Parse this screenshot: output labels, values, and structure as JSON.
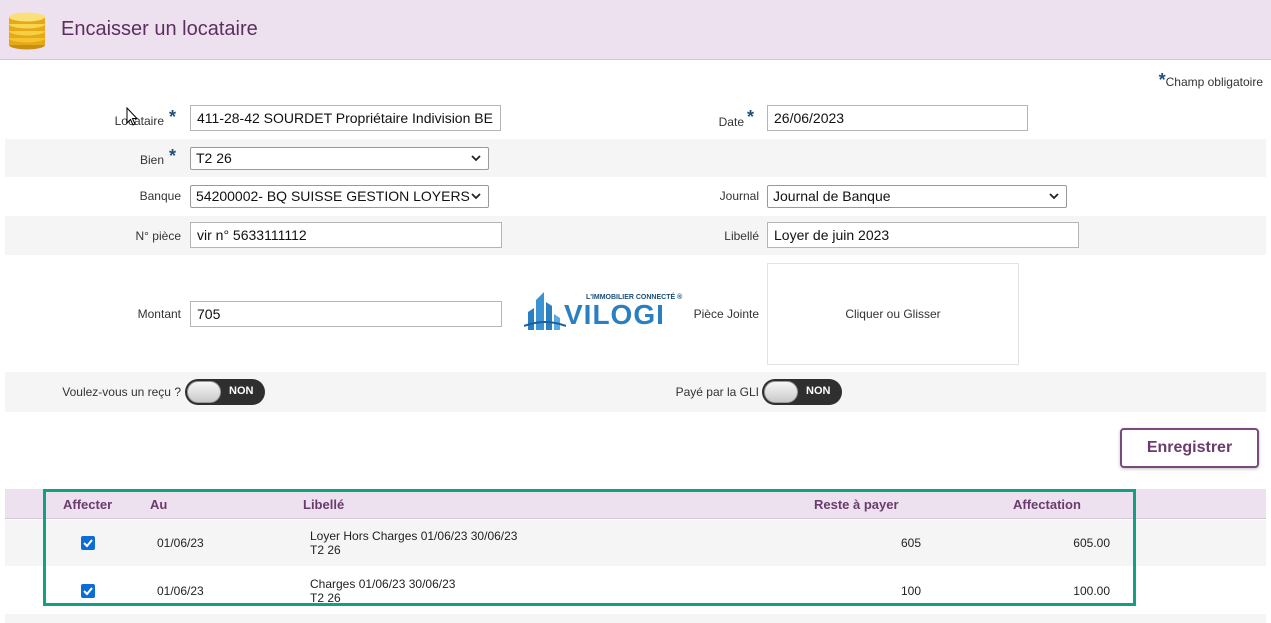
{
  "header": {
    "title": "Encaisser un locataire",
    "icon": "coins-icon"
  },
  "required_note": {
    "star": "*",
    "text": "Champ obligatoire"
  },
  "form": {
    "locataire": {
      "label": "Locataire",
      "value": "411-28-42 SOURDET  Propriétaire Indivision BE",
      "required": true
    },
    "date": {
      "label": "Date",
      "value": "26/06/2023",
      "required": true
    },
    "bien": {
      "label": "Bien",
      "value": "T2 26",
      "required": true
    },
    "banque": {
      "label": "Banque",
      "value": "54200002- BQ SUISSE GESTION LOYERS"
    },
    "journal": {
      "label": "Journal",
      "value": "Journal de Banque"
    },
    "num_piece": {
      "label": "N° pièce",
      "value": "vir n° 5633111112"
    },
    "libelle": {
      "label": "Libellé",
      "value": "Loyer de juin 2023"
    },
    "montant": {
      "label": "Montant",
      "value": "705"
    },
    "piece_jointe": {
      "label": "Pièce Jointe",
      "dropzone_text": "Cliquer ou Glisser"
    },
    "recu": {
      "label": "Voulez-vous un reçu ?",
      "toggle_text": "NON"
    },
    "gli": {
      "label": "Payé par la GLI",
      "toggle_text": "NON"
    }
  },
  "logo": {
    "tagline": "L'IMMOBILIER CONNECTÉ ®",
    "name": "VILOGI",
    "color": "#2a7fc1"
  },
  "actions": {
    "save_label": "Enregistrer"
  },
  "table": {
    "headers": {
      "affecter": "Affecter",
      "au": "Au",
      "libelle": "Libellé",
      "reste": "Reste à payer",
      "affectation": "Affectation"
    },
    "rows": [
      {
        "checked": true,
        "au": "01/06/23",
        "libelle_line1": "Loyer Hors Charges 01/06/23 30/06/23",
        "libelle_line2": "T2 26",
        "reste": "605",
        "affectation": "605.00"
      },
      {
        "checked": true,
        "au": "01/06/23",
        "libelle_line1": "Charges 01/06/23 30/06/23",
        "libelle_line2": "T2 26",
        "reste": "100",
        "affectation": "100.00"
      }
    ]
  },
  "colors": {
    "accent": "#6a3b6d",
    "header_bg": "#eee1ef",
    "highlight": "#12a083",
    "checkbox": "#0b6ed4"
  }
}
